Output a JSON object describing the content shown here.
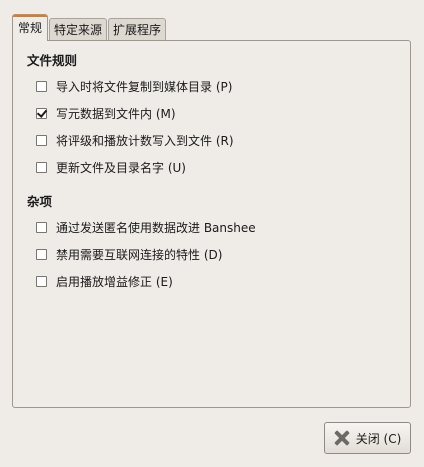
{
  "tabs": [
    {
      "label": "常规",
      "active": true
    },
    {
      "label": "特定来源",
      "active": false
    },
    {
      "label": "扩展程序",
      "active": false
    }
  ],
  "sections": {
    "file_rules": {
      "title": "文件规则",
      "items": [
        {
          "label": "导入时将文件复制到媒体目录 (P)",
          "checked": false
        },
        {
          "label": "写元数据到文件内 (M)",
          "checked": true
        },
        {
          "label": "将评级和播放计数写入到文件 (R)",
          "checked": false
        },
        {
          "label": "更新文件及目录名字 (U)",
          "checked": false
        }
      ]
    },
    "misc": {
      "title": "杂项",
      "items": [
        {
          "label": "通过发送匿名使用数据改进 Banshee",
          "checked": false
        },
        {
          "label": "禁用需要互联网连接的特性 (D)",
          "checked": false
        },
        {
          "label": "启用播放增益修正 (E)",
          "checked": false
        }
      ]
    }
  },
  "footer": {
    "close_label": "关闭 (C)",
    "close_icon": "close-icon"
  },
  "colors": {
    "background": "#efebe7",
    "active_tab_accent": "#e07a1f"
  }
}
